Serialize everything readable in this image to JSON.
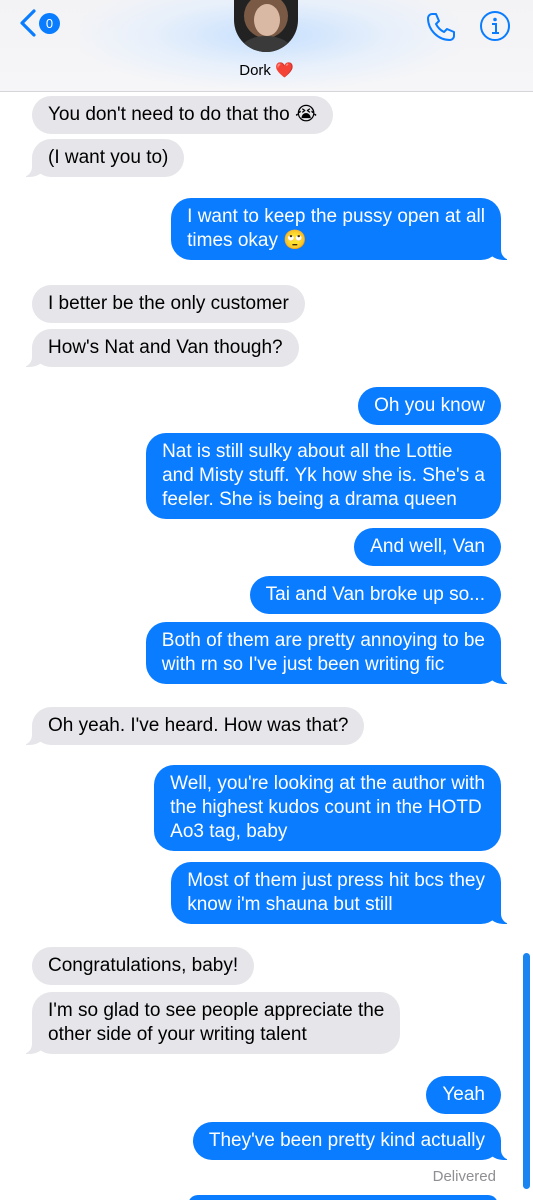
{
  "header": {
    "back_badge": "0",
    "contact_name": "Dork",
    "contact_emoji": "❤️"
  },
  "messages": [
    {
      "from": "them",
      "text": "You don't need to do that tho 😭"
    },
    {
      "from": "them",
      "text": "(I want you to)"
    },
    {
      "from": "me",
      "text": "I want to keep the pussy open at all\ntimes okay 🙄"
    },
    {
      "from": "them",
      "text": "I better be the only customer"
    },
    {
      "from": "them",
      "text": "How's Nat and Van though?"
    },
    {
      "from": "me",
      "text": "Oh you know"
    },
    {
      "from": "me",
      "text": "Nat is still sulky about all the Lottie\nand Misty stuff. Yk how she is. She's a\nfeeler. She is being a drama queen"
    },
    {
      "from": "me",
      "text": "And well, Van"
    },
    {
      "from": "me",
      "text": "Tai and Van broke up so..."
    },
    {
      "from": "me",
      "text": "Both of them are pretty annoying to be\nwith rn so I've just been writing fic"
    },
    {
      "from": "them",
      "text": "Oh yeah. I've heard. How was that?"
    },
    {
      "from": "me",
      "text": "Well, you're looking at the author with\nthe highest kudos count in the HOTD\nAo3 tag, baby"
    },
    {
      "from": "me",
      "text": "Most of them just press hit bcs they\nknow i'm shauna but still"
    },
    {
      "from": "them",
      "text": "Congratulations, baby!"
    },
    {
      "from": "them",
      "text": "I'm so glad to see people appreciate the\nother side of your writing talent"
    },
    {
      "from": "me",
      "text": "Yeah"
    },
    {
      "from": "me",
      "text": "They've been pretty kind actually"
    }
  ],
  "status": {
    "delivered": "Delivered"
  },
  "colors": {
    "outgoing": "#0a7cff",
    "incoming": "#e5e5ea",
    "accent": "#0a7cff"
  }
}
